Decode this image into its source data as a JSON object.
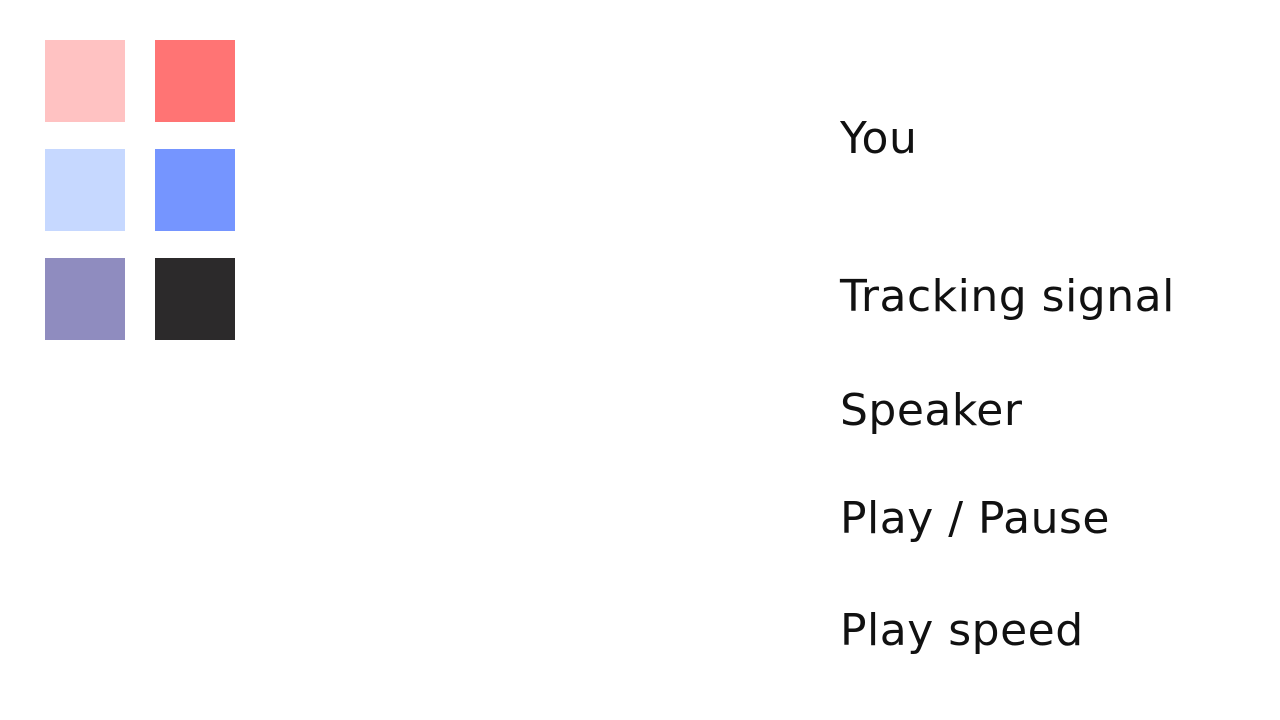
{
  "swatches": [
    {
      "name": "light-red",
      "color": "#ffc2c2"
    },
    {
      "name": "red",
      "color": "#ff7474"
    },
    {
      "name": "light-blue",
      "color": "#c6d8ff"
    },
    {
      "name": "blue",
      "color": "#7595ff"
    },
    {
      "name": "purple-gray",
      "color": "#8f8cbf"
    },
    {
      "name": "dark-charcoal",
      "color": "#2c2a2b"
    }
  ],
  "labels": {
    "you": "You",
    "tracking_signal": "Tracking signal",
    "speaker": "Speaker",
    "play_pause": "Play / Pause",
    "play_speed": "Play speed"
  }
}
